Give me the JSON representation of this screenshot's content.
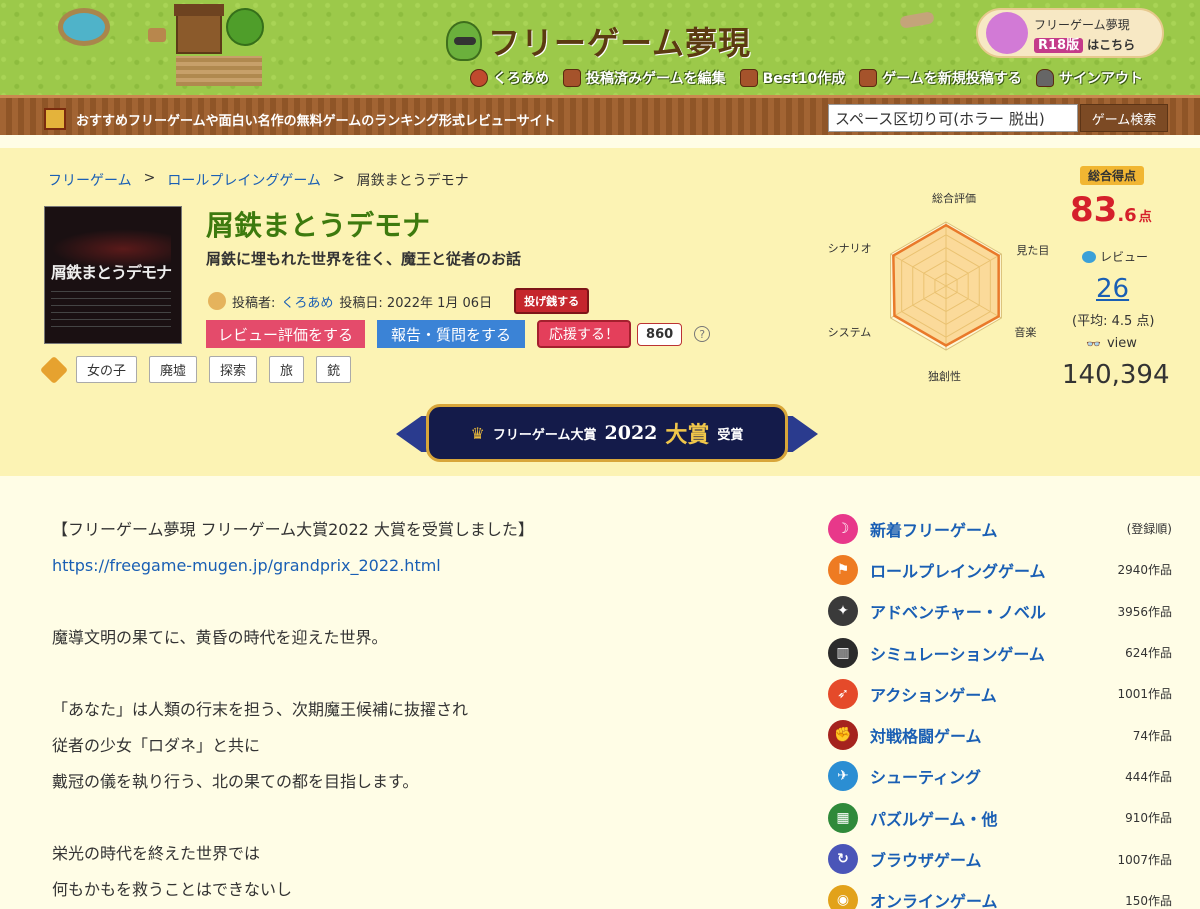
{
  "site": {
    "logo_text": "フリーゲーム夢現",
    "r18_line1": "フリーゲーム夢現",
    "r18_badge": "R18版",
    "r18_go": "はこちら",
    "tagline": "おすすめフリーゲームや面白い名作の無料ゲームのランキング形式レビューサイト"
  },
  "nav": {
    "user": "くろあめ",
    "edit": "投稿済みゲームを編集",
    "best10": "Best10作成",
    "post": "ゲームを新規投稿する",
    "signout": "サインアウト"
  },
  "search": {
    "value": "スペース区切り可(ホラー 脱出)",
    "button": "ゲーム検索"
  },
  "breadcrumb": {
    "home": "フリーゲーム",
    "sep1": ">",
    "category": "ロールプレイングゲーム",
    "sep2": ">",
    "current": "屑鉄まとうデモナ"
  },
  "game": {
    "thumb_title": "屑鉄まとうデモナ",
    "title": "屑鉄まとうデモナ",
    "subtitle": "屑鉄に埋もれた世界を往く、魔王と従者のお話",
    "poster_label": "投稿者:",
    "poster": "くろあめ",
    "date": "投稿日: 2022年 1月 06日",
    "tip_button": "投げ銭する",
    "review_button": "レビュー評価をする",
    "report_button": "報告・質問をする",
    "cheer_button": "応援する！",
    "cheer_count": "860",
    "help": "?",
    "tags": [
      "女の子",
      "廃墟",
      "探索",
      "旅",
      "銃"
    ]
  },
  "radar": {
    "labels": [
      "総合評価",
      "見た目",
      "音楽",
      "独創性",
      "システム",
      "シナリオ"
    ],
    "values": [
      0.95,
      0.95,
      0.95,
      0.93,
      0.93,
      0.95
    ],
    "colors": {
      "fill": "#f7c26a",
      "stroke": "#e9792a",
      "grid": "#d9c07a"
    }
  },
  "score": {
    "badge": "総合得点",
    "main": "83",
    "decimal": ".6",
    "unit": "点",
    "review_label": "レビュー",
    "review_count": "26",
    "average": "(平均: 4.5 点)",
    "view_icon": "👓",
    "view_label": "view",
    "view_count": "140,394"
  },
  "award": {
    "name": "フリーゲーム大賞",
    "year": "2022",
    "grand": "大賞",
    "received": "受賞"
  },
  "description": [
    "【フリーゲーム夢現 フリーゲーム大賞2022 大賞を受賞しました】",
    "https://freegame-mugen.jp/grandprix_2022.html",
    "",
    "魔導文明の果てに、黄昏の時代を迎えた世界。",
    "",
    "「あなた」は人類の行末を担う、次期魔王候補に抜擢され",
    "従者の少女「ロダネ」と共に",
    "戴冠の儀を執り行う、北の果ての都を目指します。",
    "",
    "栄光の時代を終えた世界では",
    "何もかもを救うことはできないし"
  ],
  "categories": [
    {
      "name": "新着フリーゲーム",
      "count": "(登録順)",
      "color": "#e8388a",
      "icon": "new-icon"
    },
    {
      "name": "ロールプレイングゲーム",
      "count": "2940作品",
      "color": "#ee7b22",
      "icon": "rpg-icon"
    },
    {
      "name": "アドベンチャー・ノベル",
      "count": "3956作品",
      "color": "#3a3a3a",
      "icon": "adventure-icon"
    },
    {
      "name": "シミュレーションゲーム",
      "count": "624作品",
      "color": "#2b2b2b",
      "icon": "simulation-icon"
    },
    {
      "name": "アクションゲーム",
      "count": "1001作品",
      "color": "#e54a2a",
      "icon": "action-icon"
    },
    {
      "name": "対戦格闘ゲーム",
      "count": "74作品",
      "color": "#a5231e",
      "icon": "fighting-icon"
    },
    {
      "name": "シューティング",
      "count": "444作品",
      "color": "#2b8ed3",
      "icon": "shooting-icon"
    },
    {
      "name": "パズルゲーム・他",
      "count": "910作品",
      "color": "#2f8a3a",
      "icon": "puzzle-icon"
    },
    {
      "name": "ブラウザゲーム",
      "count": "1007作品",
      "color": "#4a55b8",
      "icon": "browser-icon"
    },
    {
      "name": "オンラインゲーム",
      "count": "150作品",
      "color": "#e2a21a",
      "icon": "online-icon"
    }
  ]
}
